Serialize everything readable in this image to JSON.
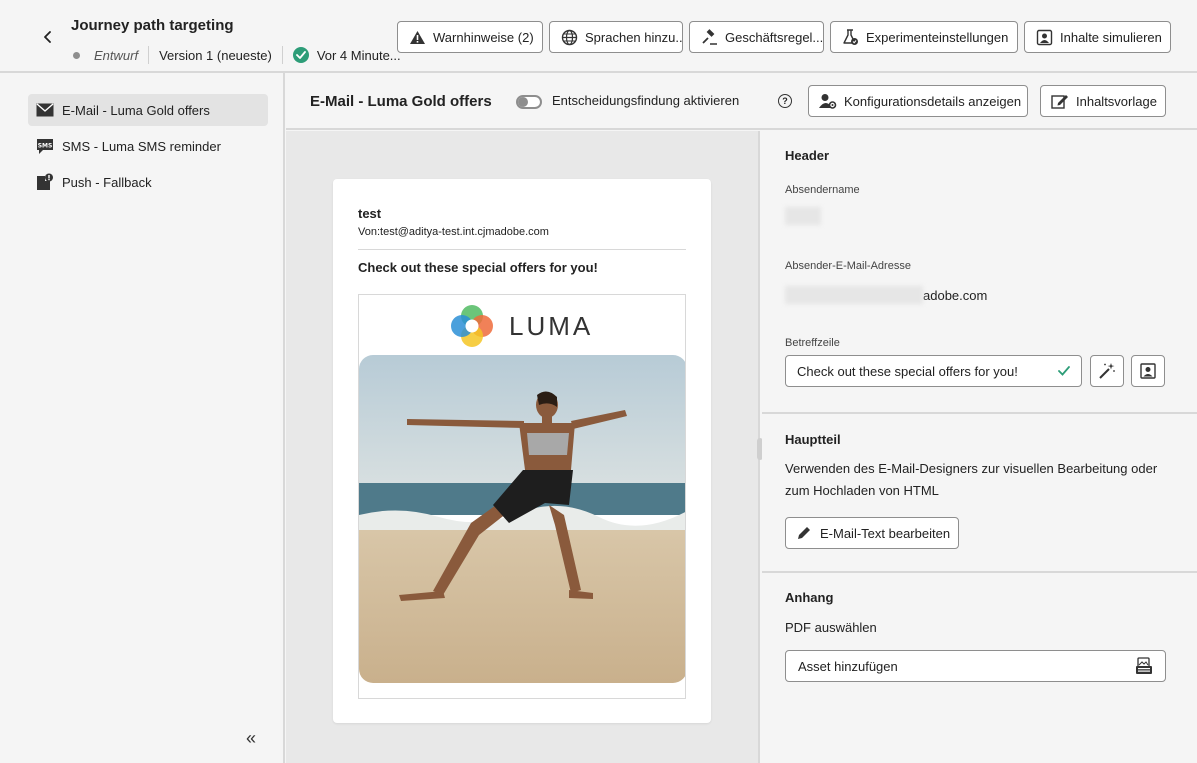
{
  "header": {
    "title": "Journey path targeting",
    "status": "Entwurf",
    "version": "Version 1 (neueste)",
    "saved": "Vor 4 Minute..."
  },
  "actions": {
    "warnings": "Warnhinweise (2)",
    "languages": "Sprachen hinzu...",
    "business_rules": "Geschäftsregel...",
    "experiment": "Experimenteinstellungen",
    "simulate": "Inhalte simulieren"
  },
  "sidebar": {
    "items": [
      {
        "label": "E-Mail - Luma Gold offers",
        "icon": "mail-icon"
      },
      {
        "label": "SMS - Luma SMS reminder",
        "icon": "sms-icon"
      },
      {
        "label": "Push - Fallback",
        "icon": "push-icon"
      }
    ],
    "collapse": "«"
  },
  "content": {
    "title": "E-Mail - Luma Gold offers",
    "decisioning_label": "Entscheidungsfindung aktivieren",
    "config_button": "Konfigurationsdetails anzeigen",
    "template_button": "Inhaltsvorlage"
  },
  "preview": {
    "name": "test",
    "from": "Von:test@aditya-test.int.cjmadobe.com",
    "subject": "Check out these special offers for you!",
    "logo_text": "LUMA"
  },
  "settings": {
    "header_title": "Header",
    "sender_name_label": "Absendername",
    "sender_email_label": "Absender-E-Mail-Adresse",
    "sender_email_domain": "adobe.com",
    "subject_label": "Betreffzeile",
    "subject_value": "Check out these special offers for you!",
    "body_title": "Hauptteil",
    "body_desc": "Verwenden des E-Mail-Designers zur visuellen Bearbeitung oder zum Hochladen von HTML",
    "edit_button": "E-Mail-Text bearbeiten",
    "attachment_title": "Anhang",
    "pdf_label": "PDF auswählen",
    "asset_button": "Asset hinzufügen"
  },
  "colors": {
    "success": "#2d9d78",
    "status_dot": "#8e8e8e",
    "panel_bg": "#f5f5f5",
    "preview_bg": "#e8e8e8"
  }
}
